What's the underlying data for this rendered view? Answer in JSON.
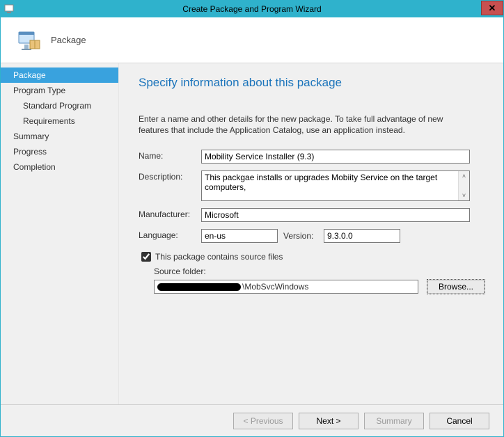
{
  "window": {
    "title": "Create Package and Program Wizard"
  },
  "header": {
    "step_label": "Package"
  },
  "nav": {
    "items": [
      {
        "label": "Package",
        "selected": true
      },
      {
        "label": "Program Type"
      },
      {
        "label": "Standard Program",
        "sub": true
      },
      {
        "label": "Requirements",
        "sub": true
      },
      {
        "label": "Summary"
      },
      {
        "label": "Progress"
      },
      {
        "label": "Completion"
      }
    ]
  },
  "page": {
    "heading": "Specify information about this package",
    "intro": "Enter a name and other details for the new package. To take full advantage of new features that include the Application Catalog, use an application instead.",
    "labels": {
      "name": "Name:",
      "description": "Description:",
      "manufacturer": "Manufacturer:",
      "language": "Language:",
      "version": "Version:",
      "contains_source": "This package contains source files",
      "source_folder": "Source folder:",
      "browse": "Browse..."
    },
    "values": {
      "name": "Mobility Service Installer (9.3)",
      "description": "This packgae installs or upgrades Mobiity Service on the target computers,",
      "manufacturer": "Microsoft",
      "language": "en-us",
      "version": "9.3.0.0",
      "contains_source_checked": true,
      "source_folder_suffix": "\\MobSvcWindows"
    }
  },
  "footer": {
    "previous": "< Previous",
    "next": "Next >",
    "summary": "Summary",
    "cancel": "Cancel"
  }
}
